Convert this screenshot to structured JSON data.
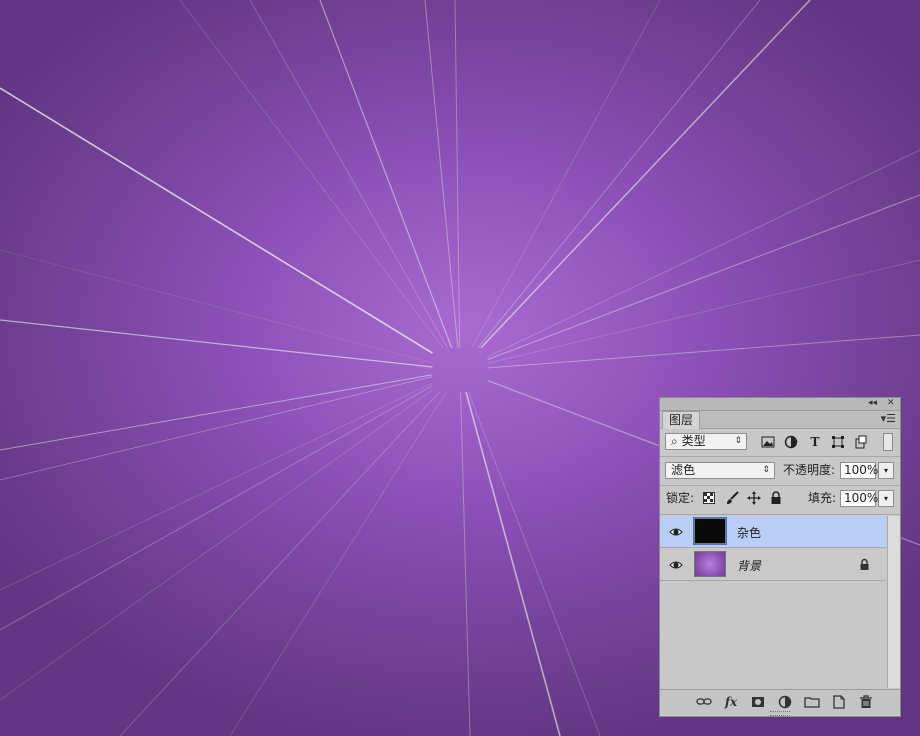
{
  "panel": {
    "collapse_glyph": "◂◂",
    "close_glyph": "✕",
    "tab_label": "图层",
    "menu_glyph": "▾☰",
    "filter": {
      "search_glyph": "⌕",
      "kind_value": "类型",
      "arrow": "⇕"
    },
    "filter_icons": [
      "image-filter-icon",
      "adjustment-filter-icon",
      "type-filter-icon",
      "shape-filter-icon",
      "smartobject-filter-icon"
    ],
    "type_glyph": "T",
    "blend_mode": "滤色",
    "opacity_label": "不透明度:",
    "opacity_value": "100%",
    "lock_label": "锁定:",
    "fill_label": "填充:",
    "fill_value": "100%",
    "dropdown_glyph": "▾"
  },
  "layers": [
    {
      "name": "杂色",
      "visible": true,
      "selected": true,
      "locked": false,
      "thumb_color": "#0a0a0a"
    },
    {
      "name": "背景",
      "visible": true,
      "selected": false,
      "locked": true,
      "thumb_color": "#8a4fc0"
    }
  ],
  "bottom_icons": [
    "link-layers-icon",
    "fx-icon",
    "layer-mask-icon",
    "adjustment-layer-icon",
    "group-folder-icon",
    "new-layer-icon",
    "trash-icon"
  ],
  "fx_label": "fx",
  "colors": {
    "canvas_center": "#a96bd0",
    "canvas_edge": "#633683",
    "selection": "#b9cdf6"
  }
}
